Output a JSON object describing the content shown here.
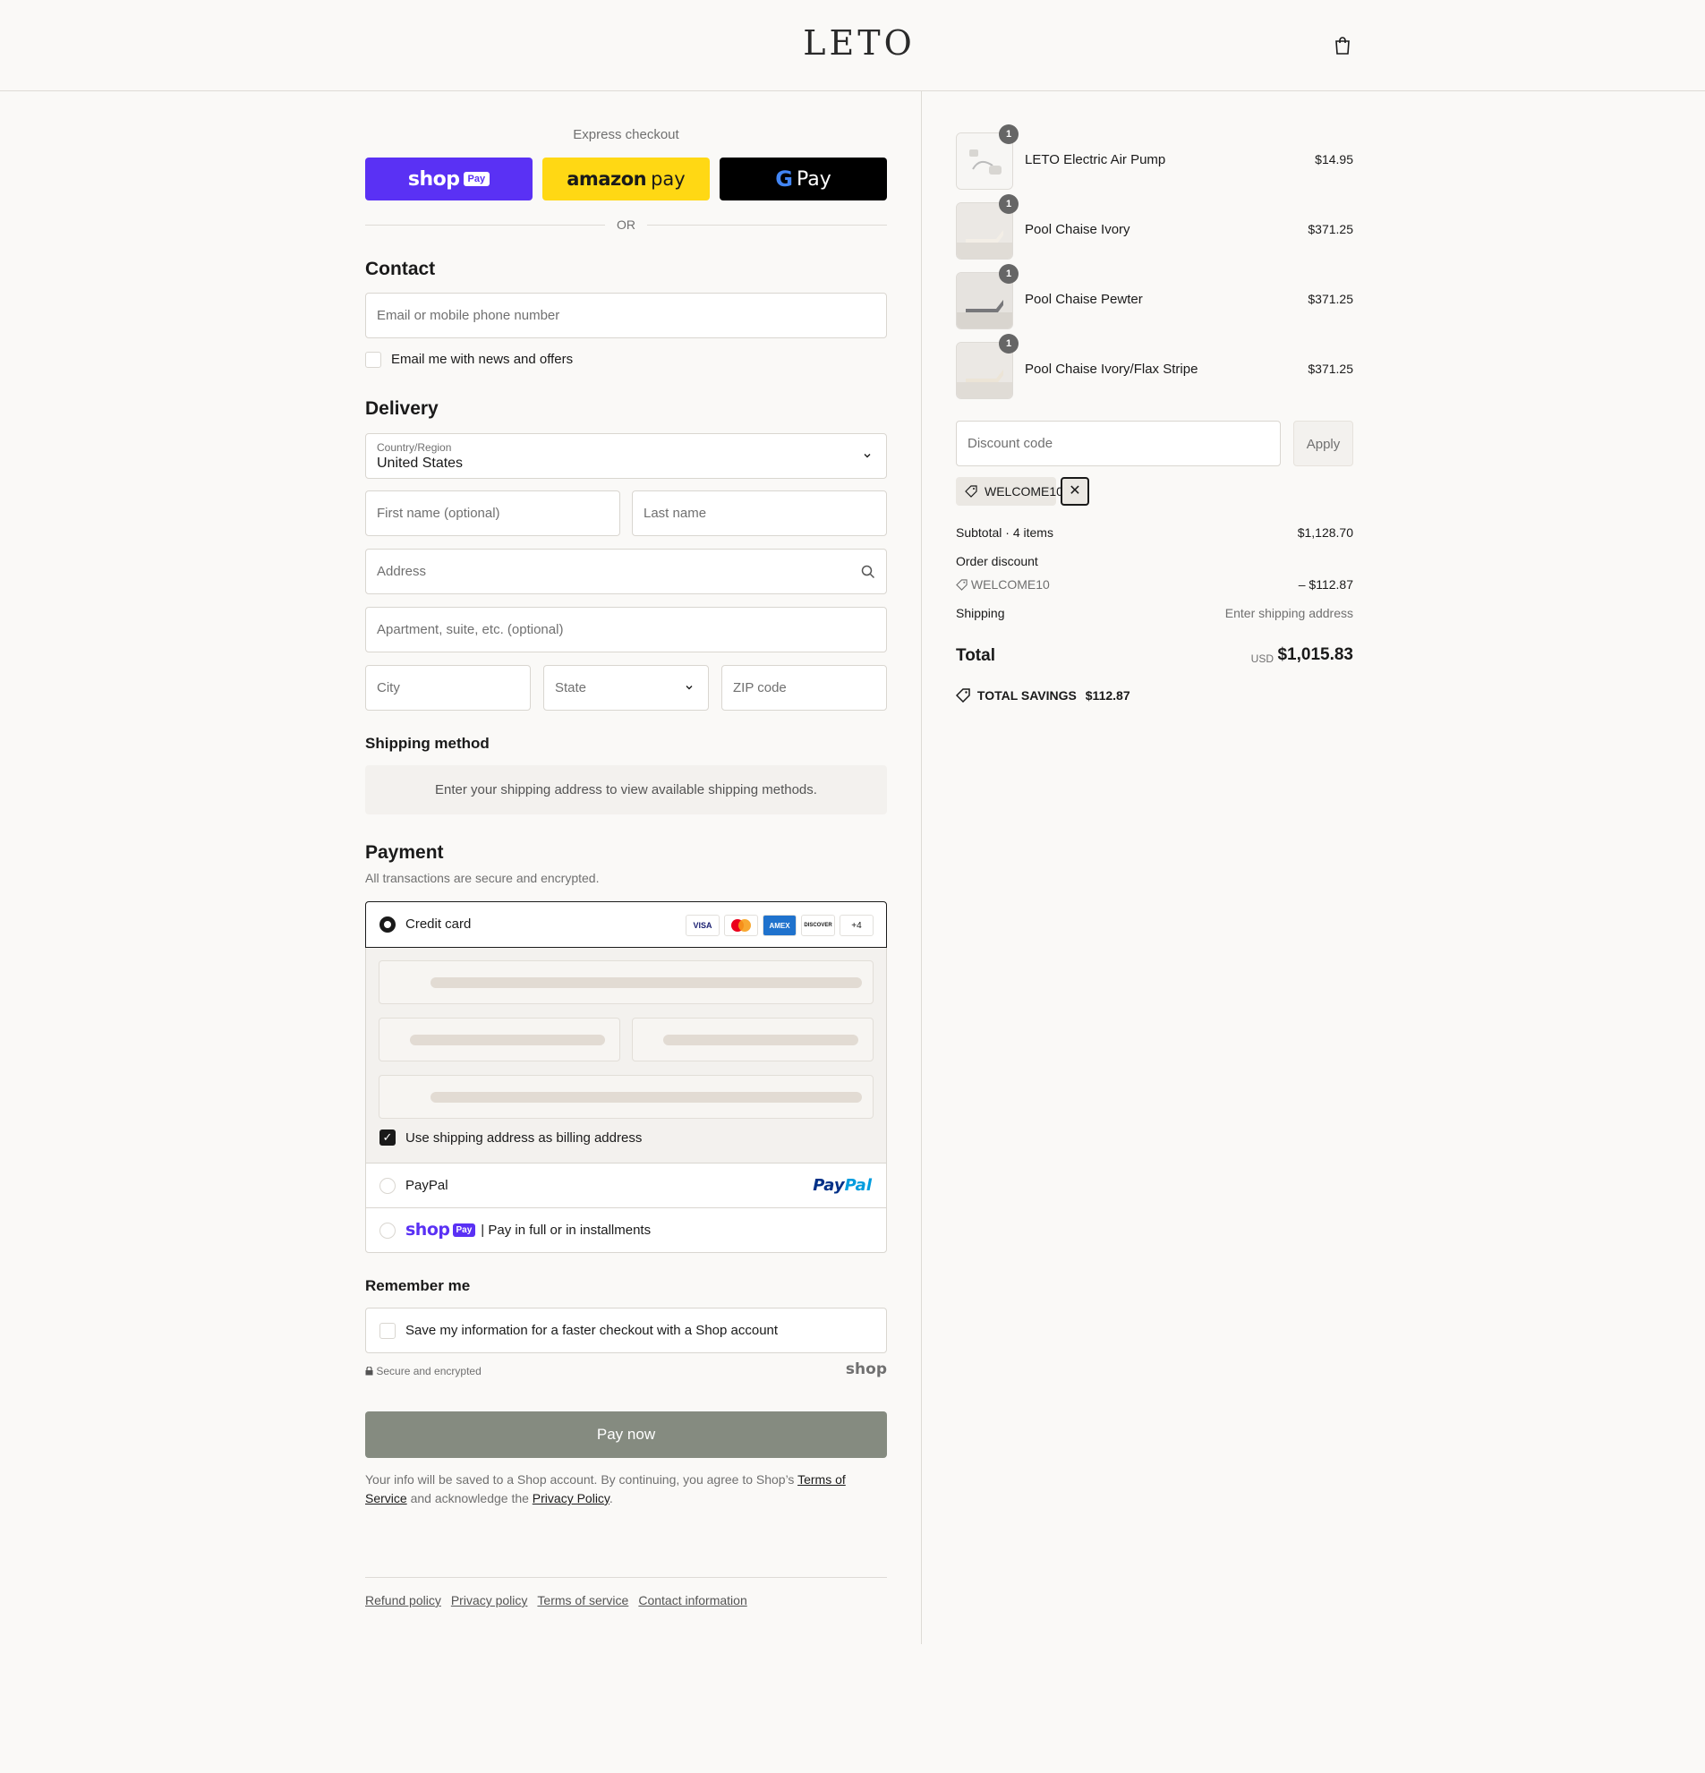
{
  "header": {
    "logo": "LETO",
    "cart_icon": "shopping-bag-icon"
  },
  "express": {
    "title": "Express checkout",
    "shop_pay": {
      "word": "shop",
      "chip": "Pay",
      "color": "#5a31f4"
    },
    "amazon_pay": {
      "word": "amazon",
      "pay": "pay",
      "color": "#ffd814"
    },
    "google_pay": {
      "g": "G",
      "pay": "Pay",
      "color": "#000000"
    },
    "or": "OR"
  },
  "contact": {
    "title": "Contact",
    "email_placeholder": "Email or mobile phone number",
    "news_label": "Email me with news and offers"
  },
  "delivery": {
    "title": "Delivery",
    "country_label": "Country/Region",
    "country_value": "United States",
    "first_name_placeholder": "First name (optional)",
    "last_name_placeholder": "Last name",
    "address_placeholder": "Address",
    "apartment_placeholder": "Apartment, suite, etc. (optional)",
    "city_placeholder": "City",
    "state_placeholder": "State",
    "zip_placeholder": "ZIP code"
  },
  "shipping_method": {
    "title": "Shipping method",
    "message": "Enter your shipping address to view available shipping methods."
  },
  "payment": {
    "title": "Payment",
    "subtitle": "All transactions are secure and encrypted.",
    "credit_card_label": "Credit card",
    "card_logos": [
      "VISA",
      "MC",
      "AMEX",
      "DISCOVER",
      "+4"
    ],
    "billing_label": "Use shipping address as billing address",
    "billing_checked": true,
    "paypal_label": "PayPal",
    "paypal_logo": {
      "pay": "Pay",
      "pal": "Pal"
    },
    "shop_pay_word": "shop",
    "shop_pay_chip": "Pay",
    "shop_pay_label": "| Pay in full or in installments"
  },
  "remember": {
    "title": "Remember me",
    "save_label": "Save my information for a faster checkout with a Shop account",
    "secure_note": "Secure and encrypted",
    "shop_brand": "shop"
  },
  "pay_now_label": "Pay now",
  "fine_print": {
    "part1": "Your info will be saved to a Shop account. By continuing, you agree to Shop’s ",
    "terms_link": "Terms of Service",
    "part2": " and acknowledge the ",
    "privacy_link": "Privacy Policy",
    "part3": "."
  },
  "footer_links": [
    "Refund policy",
    "Privacy policy",
    "Terms of service",
    "Contact information"
  ],
  "order": {
    "items": [
      {
        "name": "LETO Electric Air Pump",
        "qty": "1",
        "price": "$14.95"
      },
      {
        "name": "Pool Chaise Ivory",
        "qty": "1",
        "price": "$371.25"
      },
      {
        "name": "Pool Chaise Pewter",
        "qty": "1",
        "price": "$371.25"
      },
      {
        "name": "Pool Chaise Ivory/Flax Stripe",
        "qty": "1",
        "price": "$371.25"
      }
    ],
    "discount_placeholder": "Discount code",
    "apply_label": "Apply",
    "applied_code": "WELCOME10",
    "remove_code_glyph": "✕",
    "subtotal_label": "Subtotal · 4 items",
    "subtotal_value": "$1,128.70",
    "order_discount_label": "Order discount",
    "order_discount_code": "WELCOME10",
    "order_discount_value": "– $112.87",
    "shipping_label": "Shipping",
    "shipping_value": "Enter shipping address",
    "total_label": "Total",
    "currency": "USD",
    "total_value": "$1,015.83",
    "savings_label": "TOTAL SAVINGS",
    "savings_value": "$112.87"
  }
}
